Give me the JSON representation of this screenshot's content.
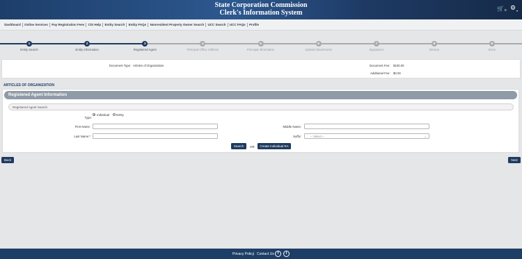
{
  "header": {
    "title_line1": "State Corporation Commission",
    "title_line2": "Clerk's Information System",
    "cart_count": "0",
    "cart_icon": "cart-icon",
    "settings_icon": "gear-icon"
  },
  "nav": {
    "items": [
      "Dashboard",
      "Online Services",
      "Pay Registration Fees",
      "CIS Help",
      "Entity Search",
      "Entity FAQs",
      "Nonresident Property Owner Search",
      "UCC Search",
      "UCC FAQs",
      "Profile"
    ]
  },
  "progress": {
    "steps": [
      "Entity Search",
      "Entity Information",
      "Registered Agent",
      "Principal Office Address",
      "Principal Information",
      "Upload Attachments",
      "Signatures",
      "Review",
      "Done"
    ],
    "current_step": 3,
    "active_color": "#1f3a5f",
    "inactive_color": "#a9abad"
  },
  "document": {
    "type_label": "Document Type:",
    "type_value": "Articles of Organization",
    "fee_label": "Document Fee:",
    "fee_value": "$100.00",
    "additional_label": "Additional Fee:",
    "additional_value": "$0.00"
  },
  "section": {
    "title": "ARTICLES OF ORGANIZATION"
  },
  "ra": {
    "panel_title": "Registered Agent Information",
    "search_title": "Registered Agent Search",
    "type_label": "Type:",
    "type_options": [
      "Individual",
      "Entity"
    ],
    "selected_type": "Individual",
    "first_name_label": "First Name:",
    "first_name_value": "",
    "middle_name_label": "Middle Name:",
    "middle_name_value": "",
    "last_name_label": "Last Name:*",
    "last_name_value": "",
    "suffix_label": "Suffix:",
    "suffix_value": "-- Select --",
    "search_button": "Search",
    "or_text": "OR",
    "create_button": "Create Individual RA"
  },
  "buttons": {
    "back": "Back",
    "next": "Next"
  },
  "footer": {
    "privacy": "Privacy Policy",
    "separator": "|",
    "contact": "Contact Us",
    "facebook": "f",
    "twitter": "t"
  }
}
